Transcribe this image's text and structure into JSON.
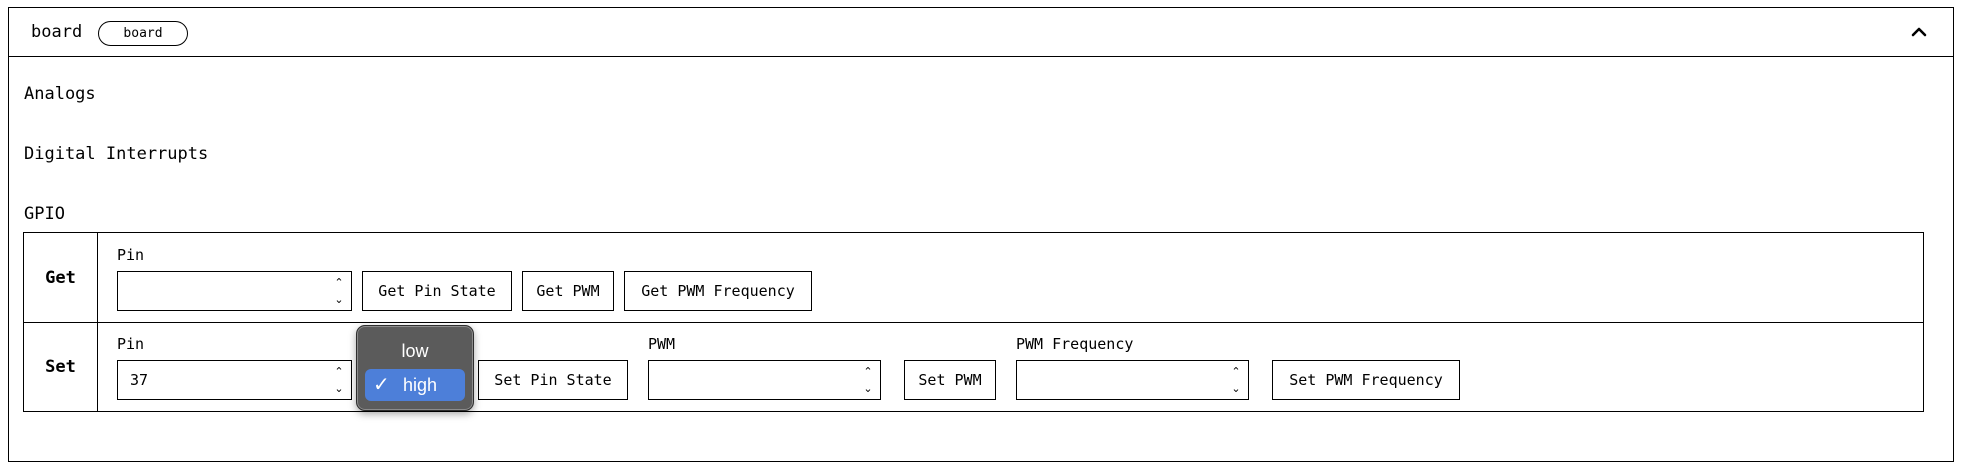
{
  "card": {
    "title": "board",
    "badge": "board",
    "collapse_icon": "chevron-up-icon"
  },
  "sections": {
    "analogs": "Analogs",
    "digital_interrupts": "Digital Interrupts",
    "gpio": "GPIO"
  },
  "gpio": {
    "get": {
      "row_label": "Get",
      "pin_label": "Pin",
      "pin_value": "",
      "buttons": {
        "get_pin_state": "Get Pin State",
        "get_pwm": "Get PWM",
        "get_pwm_frequency": "Get PWM Frequency"
      }
    },
    "set": {
      "row_label": "Set",
      "pin_label": "Pin",
      "pin_value": "37",
      "state_options": [
        "low",
        "high"
      ],
      "state_selected": "high",
      "set_pin_state": "Set Pin State",
      "pwm_label": "PWM",
      "pwm_value": "",
      "set_pwm": "Set PWM",
      "pwm_frequency_label": "PWM Frequency",
      "pwm_frequency_value": "",
      "set_pwm_frequency": "Set PWM Frequency"
    }
  },
  "colors": {
    "dropdown_bg": "#5b5b5b",
    "selected_option": "#4d7fd9"
  }
}
